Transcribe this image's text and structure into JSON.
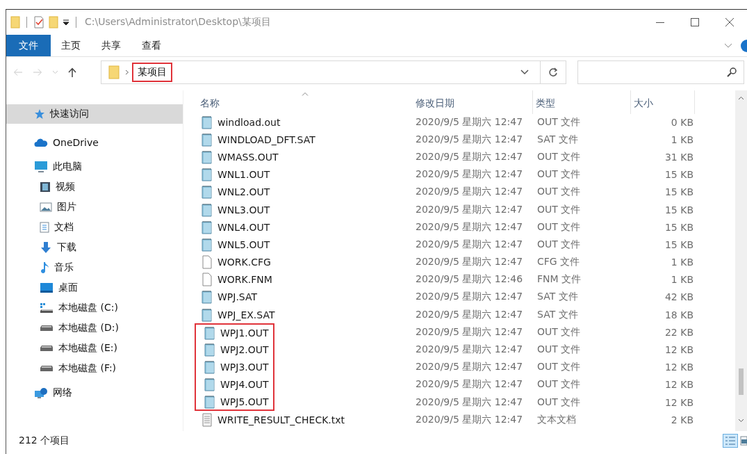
{
  "window": {
    "title": "C:\\Users\\Administrator\\Desktop\\某项目"
  },
  "ribbon": {
    "tabs": [
      {
        "label": "文件",
        "selected": true
      },
      {
        "label": "主页",
        "selected": false
      },
      {
        "label": "共享",
        "selected": false
      },
      {
        "label": "查看",
        "selected": false
      }
    ]
  },
  "address": {
    "breadcrumb": [
      {
        "label": "某项目",
        "boxed": true
      }
    ]
  },
  "sidebar": {
    "items": [
      {
        "label": "快速访问",
        "kind": "star",
        "selected": true
      },
      {
        "label": "OneDrive",
        "kind": "cloud",
        "selected": false
      },
      {
        "label": "此电脑",
        "kind": "computer",
        "selected": false,
        "children": [
          {
            "label": "视频",
            "kind": "film",
            "selected": false
          },
          {
            "label": "图片",
            "kind": "image",
            "selected": false
          },
          {
            "label": "文档",
            "kind": "document",
            "selected": false
          },
          {
            "label": "下载",
            "kind": "download",
            "selected": false
          },
          {
            "label": "音乐",
            "kind": "music",
            "selected": false
          },
          {
            "label": "桌面",
            "kind": "desktop",
            "selected": false
          },
          {
            "label": "本地磁盘 (C:)",
            "kind": "system-drive",
            "selected": false
          },
          {
            "label": "本地磁盘 (D:)",
            "kind": "drive",
            "selected": false
          },
          {
            "label": "本地磁盘 (E:)",
            "kind": "drive",
            "selected": false
          },
          {
            "label": "本地磁盘 (F:)",
            "kind": "drive",
            "selected": false
          }
        ]
      },
      {
        "label": "网络",
        "kind": "network",
        "selected": false
      }
    ]
  },
  "file_list": {
    "columns": [
      {
        "label": "名称",
        "sorted": true
      },
      {
        "label": "修改日期",
        "sorted": false
      },
      {
        "label": "类型",
        "sorted": false
      },
      {
        "label": "大小",
        "sorted": false
      }
    ],
    "rows": [
      {
        "name": "windload.out",
        "date": "2020/9/5 星期六 12:47",
        "type": "OUT 文件",
        "size": "0 KB",
        "kind": "data",
        "boxed": false
      },
      {
        "name": "WINDLOAD_DFT.SAT",
        "date": "2020/9/5 星期六 12:47",
        "type": "SAT 文件",
        "size": "1 KB",
        "kind": "data",
        "boxed": false
      },
      {
        "name": "WMASS.OUT",
        "date": "2020/9/5 星期六 12:47",
        "type": "OUT 文件",
        "size": "31 KB",
        "kind": "data",
        "boxed": false
      },
      {
        "name": "WNL1.OUT",
        "date": "2020/9/5 星期六 12:47",
        "type": "OUT 文件",
        "size": "15 KB",
        "kind": "data",
        "boxed": false
      },
      {
        "name": "WNL2.OUT",
        "date": "2020/9/5 星期六 12:47",
        "type": "OUT 文件",
        "size": "15 KB",
        "kind": "data",
        "boxed": false
      },
      {
        "name": "WNL3.OUT",
        "date": "2020/9/5 星期六 12:47",
        "type": "OUT 文件",
        "size": "15 KB",
        "kind": "data",
        "boxed": false
      },
      {
        "name": "WNL4.OUT",
        "date": "2020/9/5 星期六 12:47",
        "type": "OUT 文件",
        "size": "15 KB",
        "kind": "data",
        "boxed": false
      },
      {
        "name": "WNL5.OUT",
        "date": "2020/9/5 星期六 12:47",
        "type": "OUT 文件",
        "size": "15 KB",
        "kind": "data",
        "boxed": false
      },
      {
        "name": "WORK.CFG",
        "date": "2020/9/5 星期六 12:47",
        "type": "CFG 文件",
        "size": "1 KB",
        "kind": "blank",
        "boxed": false
      },
      {
        "name": "WORK.FNM",
        "date": "2020/9/5 星期六 12:46",
        "type": "FNM 文件",
        "size": "1 KB",
        "kind": "blank",
        "boxed": false
      },
      {
        "name": "WPJ.SAT",
        "date": "2020/9/5 星期六 12:47",
        "type": "SAT 文件",
        "size": "42 KB",
        "kind": "data",
        "boxed": false
      },
      {
        "name": "WPJ_EX.SAT",
        "date": "2020/9/5 星期六 12:47",
        "type": "SAT 文件",
        "size": "18 KB",
        "kind": "data",
        "boxed": false
      },
      {
        "name": "WPJ1.OUT",
        "date": "2020/9/5 星期六 12:47",
        "type": "OUT 文件",
        "size": "22 KB",
        "kind": "data",
        "boxed": true
      },
      {
        "name": "WPJ2.OUT",
        "date": "2020/9/5 星期六 12:47",
        "type": "OUT 文件",
        "size": "12 KB",
        "kind": "data",
        "boxed": true
      },
      {
        "name": "WPJ3.OUT",
        "date": "2020/9/5 星期六 12:47",
        "type": "OUT 文件",
        "size": "12 KB",
        "kind": "data",
        "boxed": true
      },
      {
        "name": "WPJ4.OUT",
        "date": "2020/9/5 星期六 12:47",
        "type": "OUT 文件",
        "size": "12 KB",
        "kind": "data",
        "boxed": true
      },
      {
        "name": "WPJ5.OUT",
        "date": "2020/9/5 星期六 12:47",
        "type": "OUT 文件",
        "size": "12 KB",
        "kind": "data",
        "boxed": true
      },
      {
        "name": "WRITE_RESULT_CHECK.txt",
        "date": "2020/9/5 星期六 12:47",
        "type": "文本文档",
        "size": "2 KB",
        "kind": "text",
        "boxed": false
      }
    ]
  },
  "status_bar": {
    "item_count": "212 个项目"
  }
}
